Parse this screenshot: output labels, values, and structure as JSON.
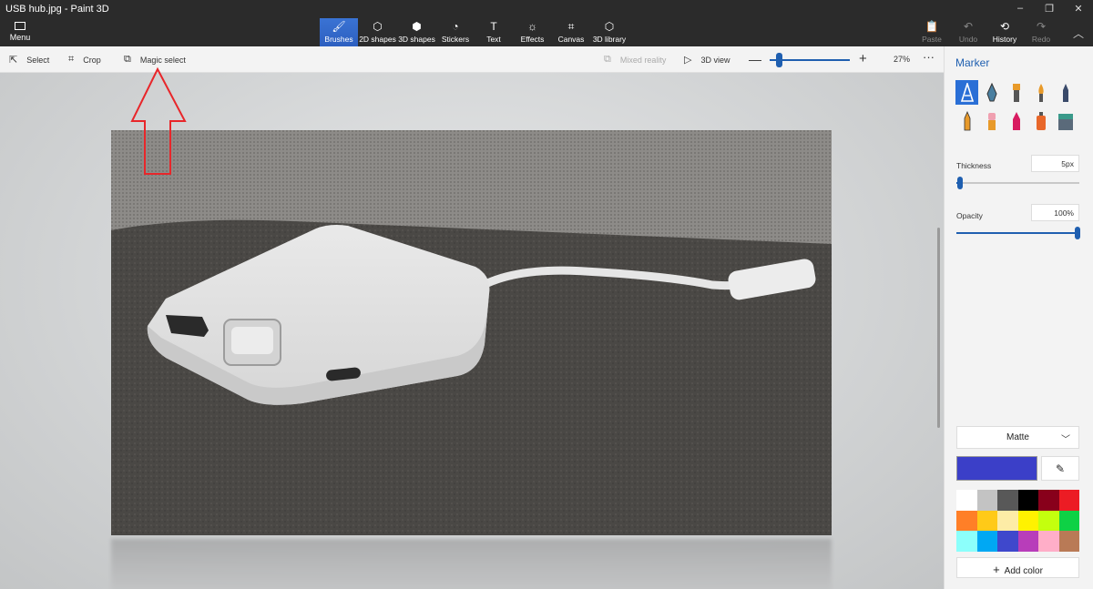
{
  "window": {
    "title": "USB hub.jpg - Paint 3D"
  },
  "menu": {
    "label": "Menu"
  },
  "tools": [
    {
      "label": "Brushes",
      "icon": "brush-icon"
    },
    {
      "label": "2D shapes",
      "icon": "2d-shapes-icon"
    },
    {
      "label": "3D shapes",
      "icon": "3d-shapes-icon"
    },
    {
      "label": "Stickers",
      "icon": "stickers-icon"
    },
    {
      "label": "Text",
      "icon": "text-icon"
    },
    {
      "label": "Effects",
      "icon": "effects-icon"
    },
    {
      "label": "Canvas",
      "icon": "canvas-icon"
    },
    {
      "label": "3D library",
      "icon": "3d-library-icon"
    }
  ],
  "active_tool": "Brushes",
  "history_bar": {
    "paste": "Paste",
    "undo": "Undo",
    "history": "History",
    "redo": "Redo"
  },
  "subbar": {
    "select": "Select",
    "crop": "Crop",
    "magic_select": "Magic select",
    "mixed_reality": "Mixed reality",
    "view_3d": "3D view",
    "zoom": "27%",
    "zoom_level": 0.05
  },
  "panel": {
    "title": "Marker",
    "brushes": [
      "marker",
      "calligraphy-pen",
      "oil-brush",
      "watercolor",
      "pixel-pen",
      "pencil",
      "eraser",
      "crayon",
      "spray-can",
      "fill"
    ],
    "selected_brush": "marker",
    "thickness_label": "Thickness",
    "thickness_value": "5px",
    "thickness_level": 0.03,
    "opacity_label": "Opacity",
    "opacity_value": "100%",
    "opacity_level": 1.0,
    "finish": "Matte",
    "current_color": "#3b3fc8",
    "add_color": "Add color",
    "palette": [
      "#ffffff",
      "#c3c3c3",
      "#585858",
      "#000000",
      "#88001b",
      "#ec1c24",
      "#ff7f27",
      "#ffca18",
      "#fdeca6",
      "#fff200",
      "#c4ff0e",
      "#0ed145",
      "#8cfffb",
      "#00a8f3",
      "#3f48cc",
      "#b83dba",
      "#ffaec8",
      "#b97a56"
    ]
  },
  "colors": {
    "accent": "#1f5fb0",
    "annotation_arrow": "#e8262a"
  }
}
